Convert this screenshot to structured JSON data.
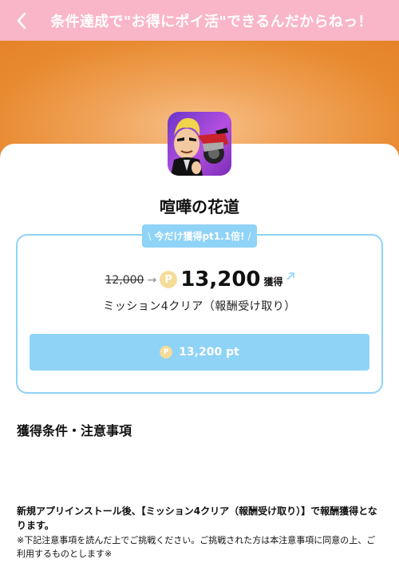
{
  "header": {
    "title": "条件達成で\"お得にポイ活\"できるんだからねっ！",
    "back_icon": "chevron-left-icon",
    "background_color": "#f9b6c8"
  },
  "banner": {
    "colors": [
      "#f7c08a",
      "#e5822a"
    ]
  },
  "app": {
    "name": "喧嘩の花道",
    "icon": "app-icon-biker-character"
  },
  "reward": {
    "bonus_tag": "今だけ獲得pt1.1倍!",
    "bonus_tag_left": "\\",
    "bonus_tag_right": "/",
    "old_points": "12,000",
    "coin_symbol": "P",
    "new_points": "13,200",
    "earn_label": "獲得",
    "mission": "ミッション4クリア（報酬受け取り）",
    "button_label": "13,200 pt",
    "accent_color": "#8fd3f7"
  },
  "conditions": {
    "title": "獲得条件・注意事項",
    "main_text": "新規アプリインストール後、【ミッション4クリア（報酬受け取り）】で報酬獲得となります。",
    "note_text": "※下記注意事項を読んだ上でご挑戦ください。ご挑戦された方は本注意事項に同意の上、ご利用するものとします※"
  }
}
